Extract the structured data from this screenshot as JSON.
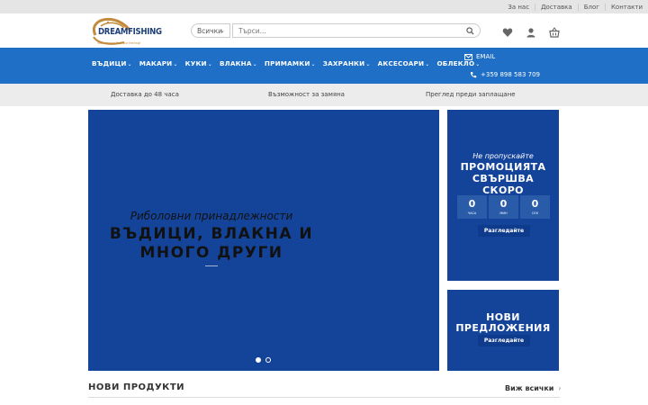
{
  "topbar": {
    "links": [
      "За нас",
      "Доставка",
      "Блог",
      "Контакти"
    ]
  },
  "header": {
    "logo_text": "DREAMFISHING",
    "logo_tagline": "Your dream fish our feeling!",
    "category_select": "Всички",
    "search_placeholder": "Търси..."
  },
  "nav": {
    "items": [
      "ВЪДИЦИ",
      "МАКАРИ",
      "КУКИ",
      "ВЛАКНА",
      "ПРИМАМКИ",
      "ЗАХРАНКИ",
      "АКСЕСОАРИ",
      "ОБЛЕКЛО"
    ],
    "email": "EMAIL",
    "phone": "+359 898 583 709"
  },
  "features": [
    "Доставка до 48 часа",
    "Възможност за замяна",
    "Преглед преди заплащане"
  ],
  "hero": {
    "subtitle": "Риболовни принадлежности",
    "title_line1": "ВЪДИЦИ, ВЛАКНА И",
    "title_line2": "МНОГО ДРУГИ"
  },
  "promo": {
    "pre": "Не пропускайте",
    "title_line1": "ПРОМОЦИЯТА",
    "title_line2": "СВЪРШВА",
    "title_line3": "СКОРО",
    "countdown": [
      {
        "value": "0",
        "label": "ЧАСА"
      },
      {
        "value": "0",
        "label": "МИН"
      },
      {
        "value": "0",
        "label": "СЕК"
      }
    ],
    "button": "Разгледайте"
  },
  "new_offers": {
    "title_line1": "НОВИ",
    "title_line2": "ПРЕДЛОЖЕНИЯ",
    "button": "Разгледайте"
  },
  "new_products": {
    "title": "НОВИ ПРОДУКТИ",
    "view_all": "Виж всички"
  },
  "colors": {
    "nav_bg": "#1f6fc7",
    "banner_bg": "#14449a",
    "logo_gold": "#c28a3b"
  }
}
